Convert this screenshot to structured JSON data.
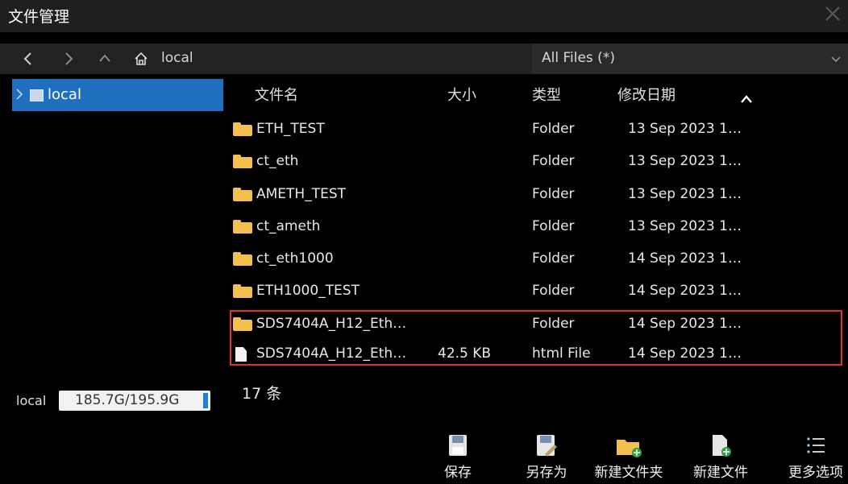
{
  "window": {
    "title": "文件管理"
  },
  "nav": {
    "back": "<",
    "forward": ">",
    "up": "^",
    "path": "local"
  },
  "filter": {
    "selected": "All Files (*)"
  },
  "tree": {
    "label": "local"
  },
  "columns": {
    "name": "文件名",
    "size": "大小",
    "type": "类型",
    "modified": "修改日期"
  },
  "rows": [
    {
      "name": "ETH_TEST",
      "size": "",
      "type": "Folder",
      "modified": "13 Sep 2023 1…",
      "kind": "folder"
    },
    {
      "name": "ct_eth",
      "size": "",
      "type": "Folder",
      "modified": "13 Sep 2023 1…",
      "kind": "folder"
    },
    {
      "name": "AMETH_TEST",
      "size": "",
      "type": "Folder",
      "modified": "13 Sep 2023 1…",
      "kind": "folder"
    },
    {
      "name": "ct_ameth",
      "size": "",
      "type": "Folder",
      "modified": "13 Sep 2023 1…",
      "kind": "folder"
    },
    {
      "name": "ct_eth1000",
      "size": "",
      "type": "Folder",
      "modified": "14 Sep 2023 1…",
      "kind": "folder"
    },
    {
      "name": "ETH1000_TEST",
      "size": "",
      "type": "Folder",
      "modified": "14 Sep 2023 1…",
      "kind": "folder"
    },
    {
      "name": "SDS7404A_H12_Eth…",
      "size": "",
      "type": "Folder",
      "modified": "14 Sep 2023 1…",
      "kind": "folder"
    },
    {
      "name": "SDS7404A_H12_Eth…",
      "size": "42.5 KB",
      "type": "html File",
      "modified": "14 Sep 2023 1…",
      "kind": "file"
    }
  ],
  "storage": {
    "label": "local",
    "usage": "185.7G/195.9G",
    "used_fraction": 0.948
  },
  "status": {
    "count": "17 条"
  },
  "toolbar": {
    "save": "保存",
    "save_as": "另存为",
    "new_folder": "新建文件夹",
    "new_file": "新建文件",
    "more": "更多选项"
  },
  "colors": {
    "selection": "#1f6fbf",
    "highlight_border": "#e0302f",
    "folder": "#f4c04d"
  }
}
